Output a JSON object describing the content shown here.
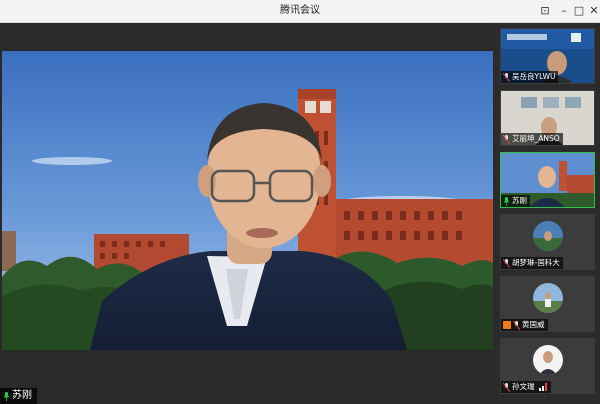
{
  "window": {
    "title": "腾讯会议",
    "buttons": {
      "pin": "⊡",
      "minimize": "–",
      "maximize": "□",
      "close": "✕"
    }
  },
  "main_speaker": {
    "name": "苏刚"
  },
  "participants": [
    {
      "name": "吴岳良YLWU",
      "active": false
    },
    {
      "name": "艾丽坤_ANSO",
      "active": false
    },
    {
      "name": "苏刚",
      "active": true
    },
    {
      "name": "胡梦琳-国科大",
      "active": false
    },
    {
      "name": "黄国威",
      "active": false
    },
    {
      "name": "孙文瑞",
      "active": false
    }
  ],
  "colors": {
    "active_border": "#2fbf4a",
    "mic_on": "#33cc55",
    "title_bar": "#f3f3f3"
  },
  "icons": {
    "mic": "mic-icon",
    "mic_muted": "mic-muted-icon",
    "signal": "signal-bars-icon",
    "screen": "share-screen-icon"
  }
}
